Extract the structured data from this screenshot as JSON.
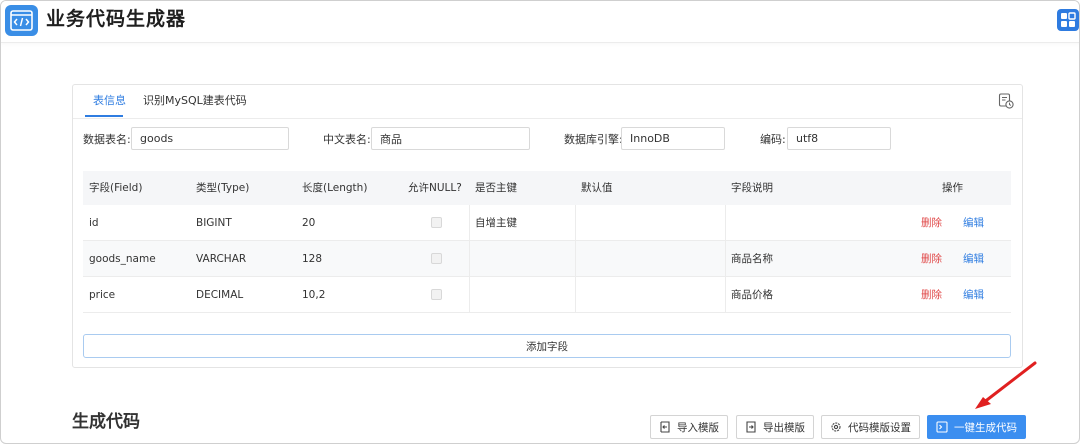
{
  "app": {
    "title": "业务代码生成器"
  },
  "tabs": [
    {
      "label": "表信息",
      "active": true
    },
    {
      "label": "识别MySQL建表代码",
      "active": false
    }
  ],
  "form": {
    "table_name_label": "数据表名:",
    "table_name_value": "goods",
    "cn_name_label": "中文表名:",
    "cn_name_value": "商品",
    "engine_label": "数据库引擎:",
    "engine_value": "InnoDB",
    "encoding_label": "编码:",
    "encoding_value": "utf8"
  },
  "table": {
    "headers": [
      "字段(Field)",
      "类型(Type)",
      "长度(Length)",
      "允许NULL?",
      "是否主键",
      "默认值",
      "字段说明",
      "操作"
    ],
    "rows": [
      {
        "field": "id",
        "type": "BIGINT",
        "length": "20",
        "nullable": false,
        "primary": "自增主键",
        "default": "",
        "comment": "",
        "delete": "删除",
        "edit": "编辑"
      },
      {
        "field": "goods_name",
        "type": "VARCHAR",
        "length": "128",
        "nullable": false,
        "primary": "",
        "default": "",
        "comment": "商品名称",
        "delete": "删除",
        "edit": "编辑"
      },
      {
        "field": "price",
        "type": "DECIMAL",
        "length": "10,2",
        "nullable": false,
        "primary": "",
        "default": "",
        "comment": "商品价格",
        "delete": "删除",
        "edit": "编辑"
      }
    ],
    "add_field_label": "添加字段"
  },
  "generate": {
    "title": "生成代码",
    "import_label": "导入模版",
    "export_label": "导出模版",
    "settings_label": "代码模版设置",
    "generate_label": "一键生成代码"
  },
  "colors": {
    "accent": "#2f7de1",
    "primary_button": "#3b8ef0",
    "danger": "#e04848",
    "annotation_arrow": "#e02020"
  },
  "icons": {
    "logo": "code-window-icon",
    "grid": "grid-icon",
    "history": "history-icon",
    "import": "import-icon",
    "export": "export-icon",
    "settings": "gear-icon",
    "generate": "terminal-icon"
  }
}
